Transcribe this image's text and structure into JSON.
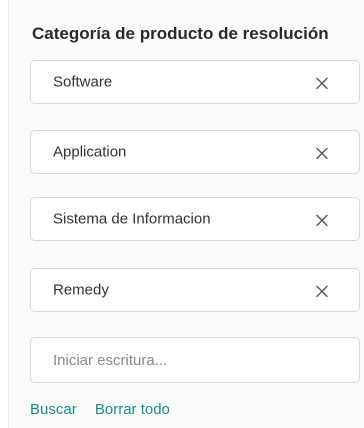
{
  "filter": {
    "title": "Categoría de producto de resolución",
    "chips": [
      {
        "label": "Software"
      },
      {
        "label": "Application"
      },
      {
        "label": "Sistema de Informacion"
      },
      {
        "label": "Remedy"
      }
    ],
    "input": {
      "placeholder": "Iniciar escritura...",
      "value": ""
    },
    "actions": {
      "search_label": "Buscar",
      "clear_label": "Borrar todo"
    }
  },
  "colors": {
    "link": "#1b8c8a",
    "chip_border": "#d9d9d9",
    "title": "#2a2a2a"
  },
  "icons": {
    "chip_remove": "close-icon"
  }
}
